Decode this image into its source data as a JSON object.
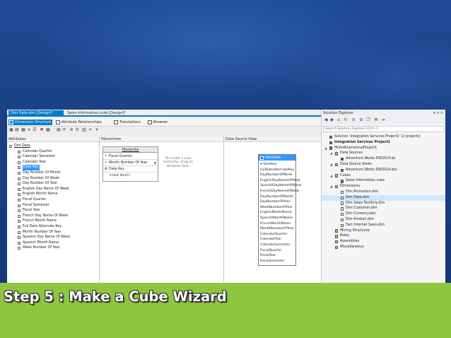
{
  "colors": {
    "accent": "#007acc",
    "selection": "#3399ff",
    "caption_band": "#8dc63f",
    "background": "#1b3f86"
  },
  "document_tabs": [
    {
      "label": "Dim Date.dim [Design]*",
      "active": true
    },
    {
      "label": "Sales Information.cube [Design]*",
      "active": false
    }
  ],
  "designer_tabs": [
    {
      "label": "Dimension Structure",
      "icon": "dimension-structure-icon"
    },
    {
      "label": "Attribute Relationships",
      "icon": "attribute-relationships-icon"
    },
    {
      "label": "Translations",
      "icon": "translations-icon"
    },
    {
      "label": "Browser",
      "icon": "browser-icon"
    }
  ],
  "attributes_pane": {
    "header": "Attributes",
    "root": "Dim Date",
    "items": [
      "Calendar Quarter",
      "Calendar Semester",
      "Calendar Year",
      "Date Key",
      "Day Number Of Month",
      "Day Number Of Week",
      "Day Number Of Year",
      "English Day Name Of Week",
      "English Month Name",
      "Fiscal Quarter",
      "Fiscal Semester",
      "Fiscal Year",
      "French Day Name Of Week",
      "French Month Name",
      "Full Date Alternate Key",
      "Month Number Of Year",
      "Spanish Day Name Of Week",
      "Spanish Month Name",
      "Week Number Of Year"
    ],
    "selected_index": 3
  },
  "hierarchies_pane": {
    "header": "Hierarchies",
    "hierarchy_title": "Hierarchy",
    "levels": [
      "Fiscal Quarter",
      "Month Number Of Year",
      "Date Key"
    ],
    "new_level": "<new level>",
    "hint": "To create a new hierarchy, drag an attribute here."
  },
  "dsv_pane": {
    "header": "Data Source View",
    "table_name": "DimDate",
    "columns": [
      "DateKey",
      "FullDateAlternateKey",
      "DayNumberOfWeek",
      "EnglishDayNameOfWeek",
      "SpanishDayNameOfWeek",
      "FrenchDayNameOfWeek",
      "DayNumberOfMonth",
      "DayNumberOfYear",
      "WeekNumberOfYear",
      "EnglishMonthName",
      "SpanishMonthName",
      "FrenchMonthName",
      "MonthNumberOfYear",
      "CalendarQuarter",
      "CalendarYear",
      "CalendarSemester",
      "FiscalQuarter",
      "FiscalYear",
      "FiscalSemester"
    ]
  },
  "solution_explorer": {
    "title": "Solution Explorer",
    "search_placeholder": "Search Solution Explorer (Ctrl+;)",
    "tree": [
      {
        "label": "Solution 'Integration Services Project1' (2 projects)",
        "depth": 0,
        "icon": "solution-icon"
      },
      {
        "label": "Integration Services Project1",
        "depth": 0,
        "icon": "project-icon",
        "bold": true
      },
      {
        "label": "MultidimensionalProject1",
        "depth": 0,
        "icon": "project-icon"
      },
      {
        "label": "Data Sources",
        "depth": 1,
        "icon": "folder-icon"
      },
      {
        "label": "Adventure Works DW2014.ds",
        "depth": 2,
        "icon": "data-source-icon"
      },
      {
        "label": "Data Source Views",
        "depth": 1,
        "icon": "folder-icon"
      },
      {
        "label": "Adventure Works DW2014.dsv",
        "depth": 2,
        "icon": "data-source-view-icon"
      },
      {
        "label": "Cubes",
        "depth": 1,
        "icon": "folder-icon"
      },
      {
        "label": "Sales Information.cube",
        "depth": 2,
        "icon": "cube-icon"
      },
      {
        "label": "Dimensions",
        "depth": 1,
        "icon": "folder-icon"
      },
      {
        "label": "Dim Promotion.dim",
        "depth": 2,
        "icon": "dimension-icon"
      },
      {
        "label": "Dim Date.dim",
        "depth": 2,
        "icon": "dimension-icon",
        "selected": true
      },
      {
        "label": "Dim Sales Territory.dim",
        "depth": 2,
        "icon": "dimension-icon"
      },
      {
        "label": "Dim Customer.dim",
        "depth": 2,
        "icon": "dimension-icon"
      },
      {
        "label": "Dim Currency.dim",
        "depth": 2,
        "icon": "dimension-icon"
      },
      {
        "label": "Dim Product.dim",
        "depth": 2,
        "icon": "dimension-icon"
      },
      {
        "label": "Fact Internet Sales.dim",
        "depth": 2,
        "icon": "dimension-icon"
      },
      {
        "label": "Mining Structures",
        "depth": 1,
        "icon": "folder-icon"
      },
      {
        "label": "Roles",
        "depth": 1,
        "icon": "folder-icon"
      },
      {
        "label": "Assemblies",
        "depth": 1,
        "icon": "folder-icon"
      },
      {
        "label": "Miscellaneous",
        "depth": 1,
        "icon": "folder-icon"
      }
    ]
  },
  "caption": "Step 5 : Make a Cube Wizard"
}
